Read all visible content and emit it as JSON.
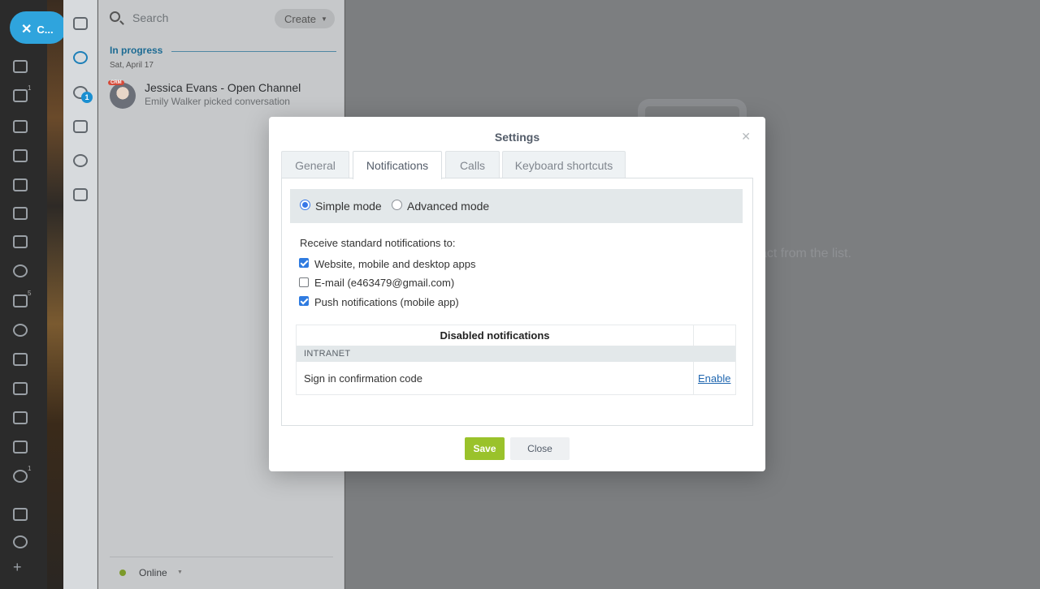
{
  "close_pill": {
    "label": "C..."
  },
  "rail_badges": [
    "1",
    "5",
    "1"
  ],
  "im_badge": "1",
  "chat_list": {
    "search_placeholder": "Search",
    "create_label": "Create",
    "section_title": "In progress",
    "section_date": "Sat, April 17",
    "crm_tag": "CRM",
    "chat_name": "Jessica Evans - Open Channel",
    "chat_sub": "Emily Walker picked conversation",
    "status": "Online"
  },
  "main": {
    "placeholder_text": "act from the list."
  },
  "modal": {
    "title": "Settings",
    "tabs": [
      {
        "label": "General"
      },
      {
        "label": "Notifications"
      },
      {
        "label": "Calls"
      },
      {
        "label": "Keyboard shortcuts"
      }
    ],
    "active_tab": "Notifications",
    "modes": [
      {
        "label": "Simple mode",
        "checked": true
      },
      {
        "label": "Advanced mode",
        "checked": false
      }
    ],
    "receive_label": "Receive standard notifications to:",
    "channels": [
      {
        "label": "Website, mobile and desktop apps",
        "checked": true
      },
      {
        "label": "E-mail (e463479@gmail.com)",
        "checked": false
      },
      {
        "label": "Push notifications (mobile app)",
        "checked": true
      }
    ],
    "disabled_table": {
      "header": "Disabled notifications",
      "group": "INTRANET",
      "row_text": "Sign in confirmation code",
      "row_action": "Enable"
    },
    "save_label": "Save",
    "close_label": "Close"
  }
}
